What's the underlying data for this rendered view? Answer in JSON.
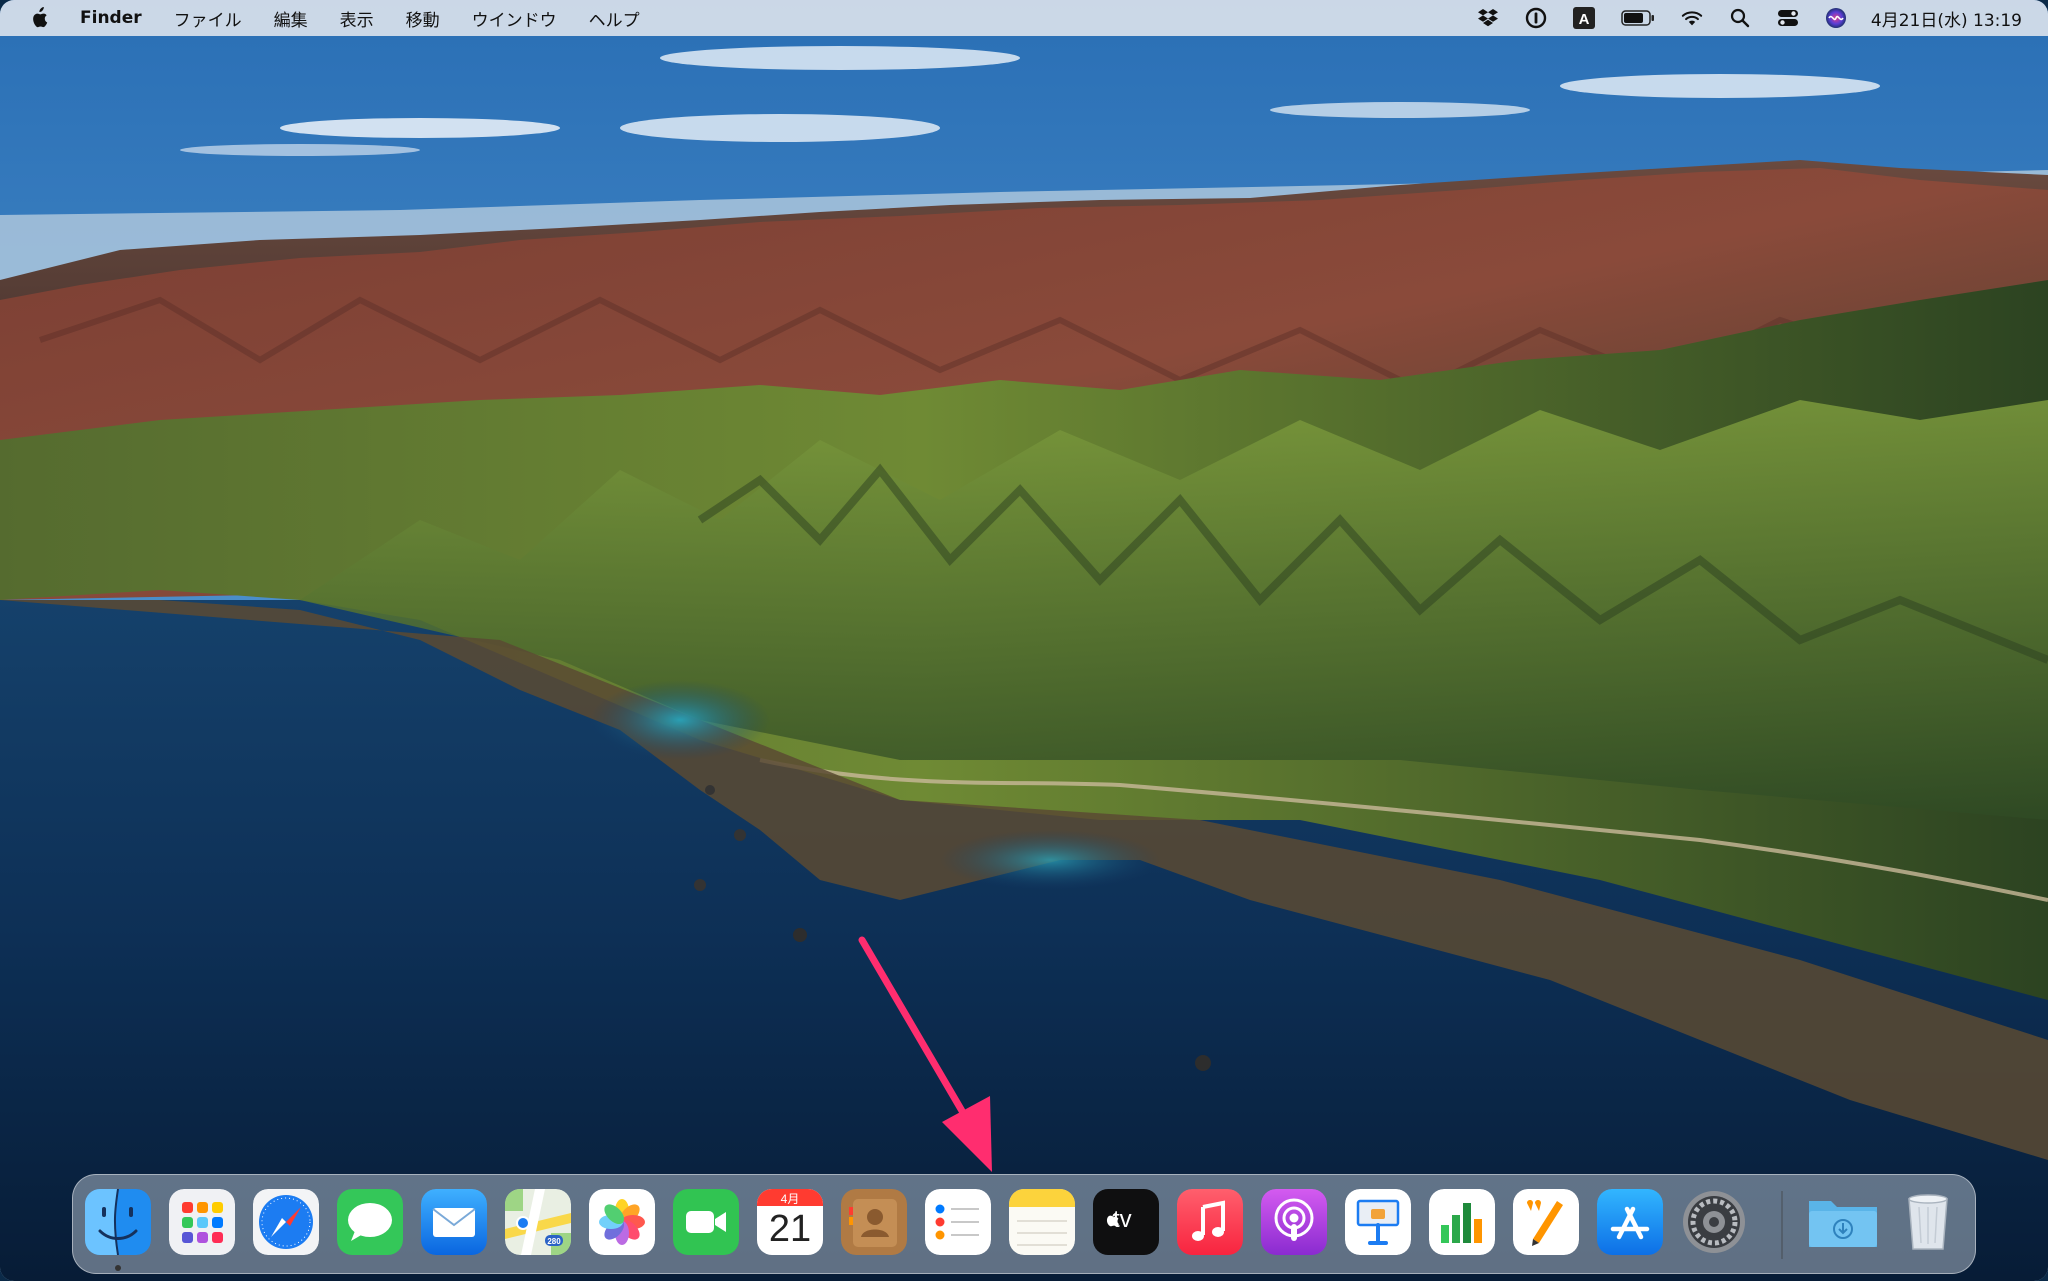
{
  "menubar": {
    "apple_icon": "apple-logo-icon",
    "items": [
      "Finder",
      "ファイル",
      "編集",
      "表示",
      "移動",
      "ウインドウ",
      "ヘルプ"
    ],
    "status_icons": [
      "dropbox-icon",
      "1password-icon",
      "input-source-icon",
      "battery-icon",
      "wifi-icon",
      "spotlight-search-icon",
      "control-center-icon",
      "siri-icon"
    ],
    "input_source_label": "A",
    "clock": "4月21日(水) 13:19"
  },
  "dock": {
    "apps": [
      {
        "name": "Finder",
        "icon": "finder-icon",
        "running": true
      },
      {
        "name": "Launchpad",
        "icon": "launchpad-icon"
      },
      {
        "name": "Safari",
        "icon": "safari-icon"
      },
      {
        "name": "Messages",
        "icon": "messages-icon"
      },
      {
        "name": "Mail",
        "icon": "mail-icon"
      },
      {
        "name": "Maps",
        "icon": "maps-icon"
      },
      {
        "name": "Photos",
        "icon": "photos-icon"
      },
      {
        "name": "FaceTime",
        "icon": "facetime-icon"
      },
      {
        "name": "Calendar",
        "icon": "calendar-icon"
      },
      {
        "name": "Contacts",
        "icon": "contacts-icon"
      },
      {
        "name": "Reminders",
        "icon": "reminders-icon",
        "highlighted": true
      },
      {
        "name": "Notes",
        "icon": "notes-icon"
      },
      {
        "name": "TV",
        "icon": "apple-tv-icon"
      },
      {
        "name": "Music",
        "icon": "music-icon"
      },
      {
        "name": "Podcasts",
        "icon": "podcasts-icon"
      },
      {
        "name": "Keynote",
        "icon": "keynote-icon"
      },
      {
        "name": "Numbers",
        "icon": "numbers-icon"
      },
      {
        "name": "Pages",
        "icon": "pages-icon"
      },
      {
        "name": "App Store",
        "icon": "app-store-icon"
      },
      {
        "name": "System Preferences",
        "icon": "system-preferences-icon"
      },
      {
        "name": "Downloads",
        "icon": "downloads-folder-icon"
      },
      {
        "name": "Trash",
        "icon": "trash-icon"
      }
    ],
    "calendar_month": "4月",
    "calendar_day": "21",
    "tv_label": "tv",
    "maps_badge": "280"
  },
  "annotation": {
    "arrow_color": "#ff2d6f",
    "target": "Reminders"
  }
}
